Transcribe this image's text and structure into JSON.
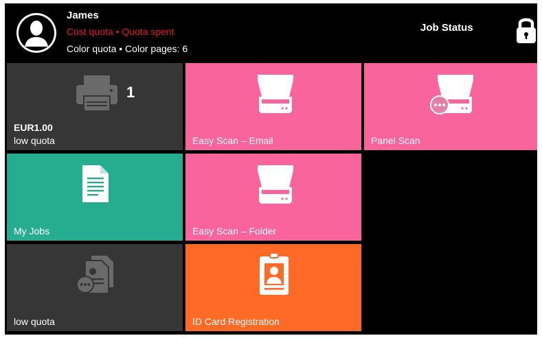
{
  "header": {
    "user_name": "James",
    "cost_quota_line": "Cost quota • Quota spent",
    "color_quota_line": "Color quota • Color pages: 6",
    "job_status_label": "Job Status",
    "icons": {
      "avatar": "user-avatar-icon",
      "lock": "lock-icon"
    }
  },
  "tiles": {
    "print": {
      "count": "1",
      "amount": "EUR1.00",
      "label": "low quota",
      "icon": "printer-icon"
    },
    "easy_scan_email": {
      "label": "Easy Scan – Email",
      "icon": "scanner-icon"
    },
    "panel_scan": {
      "label": "Panel Scan",
      "icon": "scanner-with-menu-icon"
    },
    "my_jobs": {
      "label": "My Jobs",
      "icon": "document-icon"
    },
    "easy_scan_folder": {
      "label": "Easy Scan – Folder",
      "icon": "scanner-icon"
    },
    "low_quota": {
      "label": "low quota",
      "icon": "copy-documents-icon"
    },
    "id_card_registration": {
      "label": "ID Card Registration",
      "icon": "id-card-icon"
    }
  },
  "colors": {
    "background": "#000000",
    "pink_tile": "#f9649c",
    "teal_tile": "#26ac8f",
    "orange_tile": "#ff6a26",
    "dark_tile": "#363636",
    "quota_warning_text": "#e8132e"
  }
}
